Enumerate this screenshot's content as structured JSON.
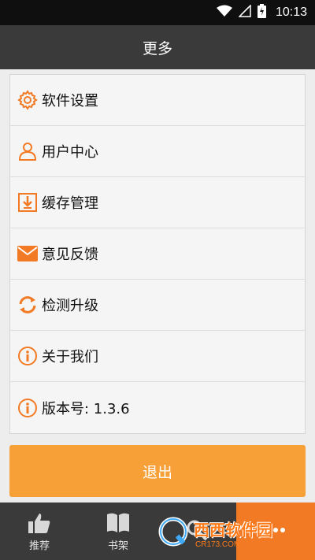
{
  "status_bar": {
    "time": "10:13",
    "icons": [
      "wifi-icon",
      "signal-icon",
      "battery-charging-icon"
    ]
  },
  "header": {
    "title": "更多"
  },
  "menu": {
    "items": [
      {
        "label": "软件设置",
        "icon": "gear-icon"
      },
      {
        "label": "用户中心",
        "icon": "user-icon"
      },
      {
        "label": "缓存管理",
        "icon": "download-icon"
      },
      {
        "label": "意见反馈",
        "icon": "mail-icon"
      },
      {
        "label": "检测升级",
        "icon": "refresh-icon"
      },
      {
        "label": "关于我们",
        "icon": "info-icon"
      },
      {
        "label": "版本号: 1.3.6",
        "icon": "info-icon"
      }
    ]
  },
  "logout": {
    "label": "退出"
  },
  "bottom_nav": {
    "tabs": [
      {
        "label": "推荐",
        "icon": "thumbs-up-icon",
        "active": false
      },
      {
        "label": "书架",
        "icon": "book-icon",
        "active": false
      },
      {
        "label": "",
        "icon": "search-icon",
        "active": false
      },
      {
        "label": "",
        "icon": "more-icon",
        "active": true
      }
    ]
  },
  "watermark": {
    "text": "西西软件园",
    "sub": "CR173.COM"
  },
  "colors": {
    "accent": "#f27a24",
    "button": "#f7a037",
    "bar": "#3a3a3a"
  }
}
